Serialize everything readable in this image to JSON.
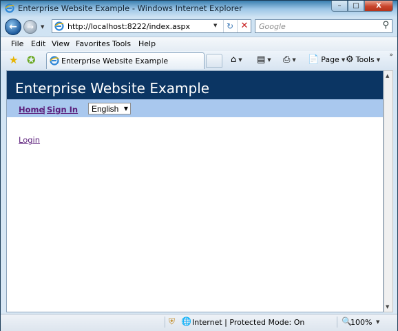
{
  "window": {
    "title": "Enterprise Website Example - Windows Internet Explorer",
    "minimize": "–",
    "maximize": "□",
    "close": "X"
  },
  "address_bar": {
    "url": "http://localhost:8222/index.aspx"
  },
  "search": {
    "placeholder": "Google"
  },
  "menu": {
    "items": [
      "File",
      "Edit",
      "View",
      "Favorites",
      "Tools",
      "Help"
    ]
  },
  "tab": {
    "title": "Enterprise Website Example"
  },
  "command_bar": {
    "page_label": "Page",
    "tools_label": "Tools"
  },
  "site": {
    "header_title": "Enterprise Website Example",
    "nav": {
      "home": "Home",
      "separator": "|",
      "sign_in": "Sign In"
    },
    "language": {
      "selected": "English"
    },
    "login_link": "Login"
  },
  "status_bar": {
    "zone": "Internet | Protected Mode: On",
    "zoom": "100%"
  },
  "colors": {
    "site_header_bg": "#0b3563",
    "site_nav_bg": "#a9c8ee",
    "link_visited": "#5a1d7a"
  }
}
